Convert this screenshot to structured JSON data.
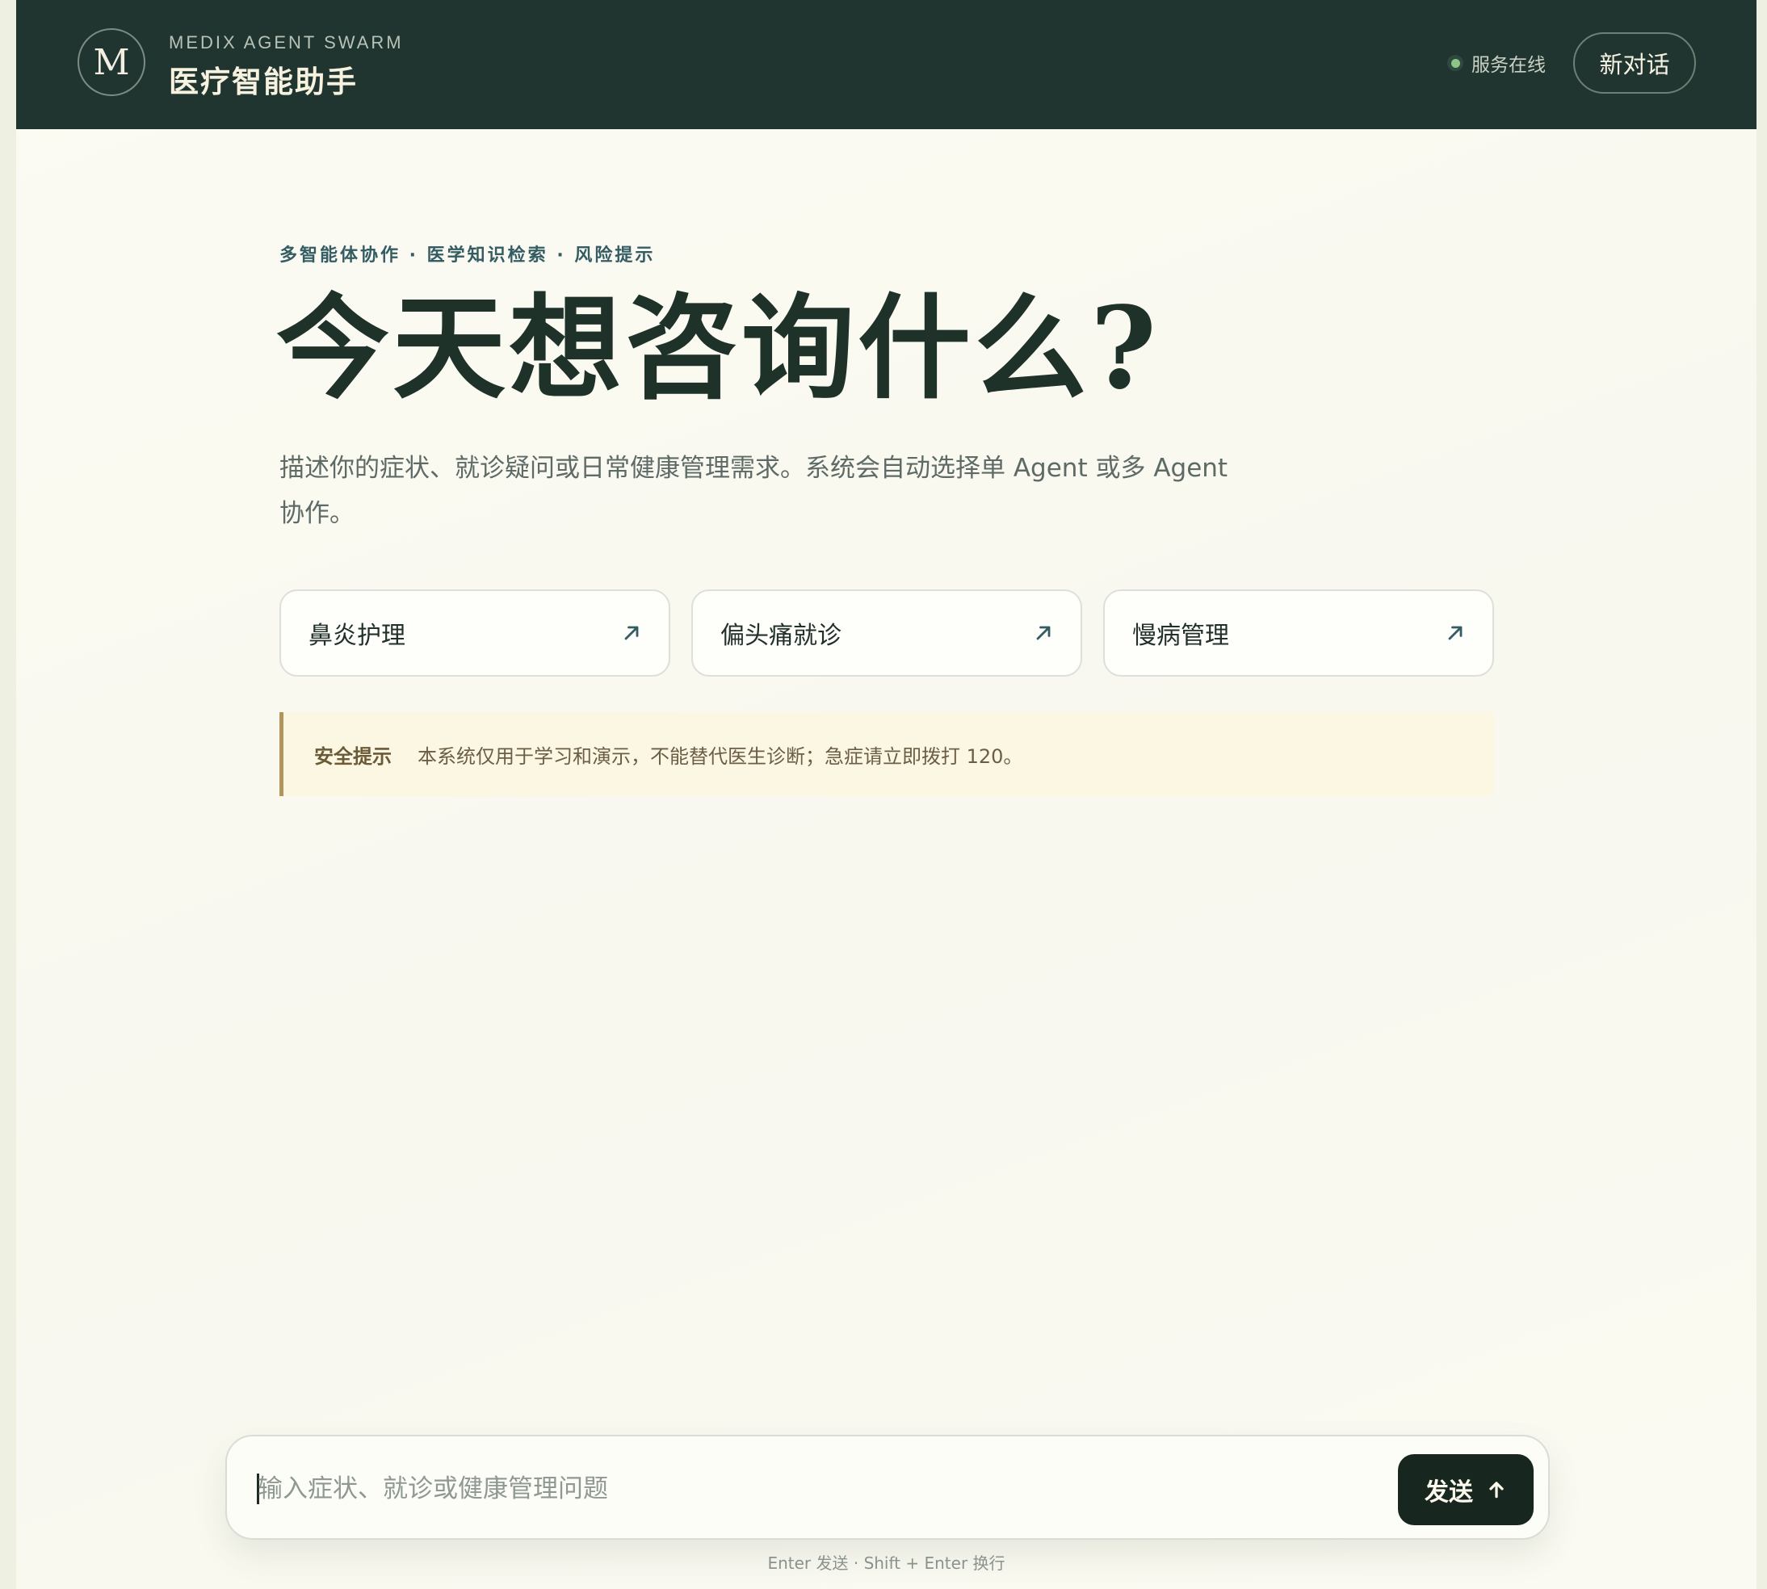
{
  "header": {
    "logo_letter": "M",
    "brand_en": "MEDIX AGENT SWARM",
    "brand_cn": "医疗智能助手",
    "status_text": "服务在线",
    "new_chat_label": "新对话"
  },
  "hero": {
    "eyebrow": "多智能体协作 · 医学知识检索 · 风险提示",
    "title": "今天想咨询什么?",
    "description": "描述你的症状、就诊疑问或日常健康管理需求。系统会自动选择单 Agent 或多 Agent 协作。"
  },
  "suggestions": [
    {
      "label": "鼻炎护理",
      "icon": "arrow-up-right-icon"
    },
    {
      "label": "偏头痛就诊",
      "icon": "arrow-up-right-icon"
    },
    {
      "label": "慢病管理",
      "icon": "arrow-up-right-icon"
    }
  ],
  "safety": {
    "label": "安全提示",
    "text": "本系统仅用于学习和演示，不能替代医生诊断；急症请立即拨打 120。"
  },
  "composer": {
    "placeholder": "输入症状、就诊或健康管理问题",
    "value": "",
    "send_label": "发送",
    "send_icon": "arrow-up-icon",
    "hint": "Enter 发送 · Shift + Enter 换行"
  },
  "colors": {
    "header_bg": "#213530",
    "accent_dark": "#17271f",
    "status_online": "#8fc487",
    "safety_border": "#b1955a",
    "safety_bg": "#fcf7e3"
  }
}
